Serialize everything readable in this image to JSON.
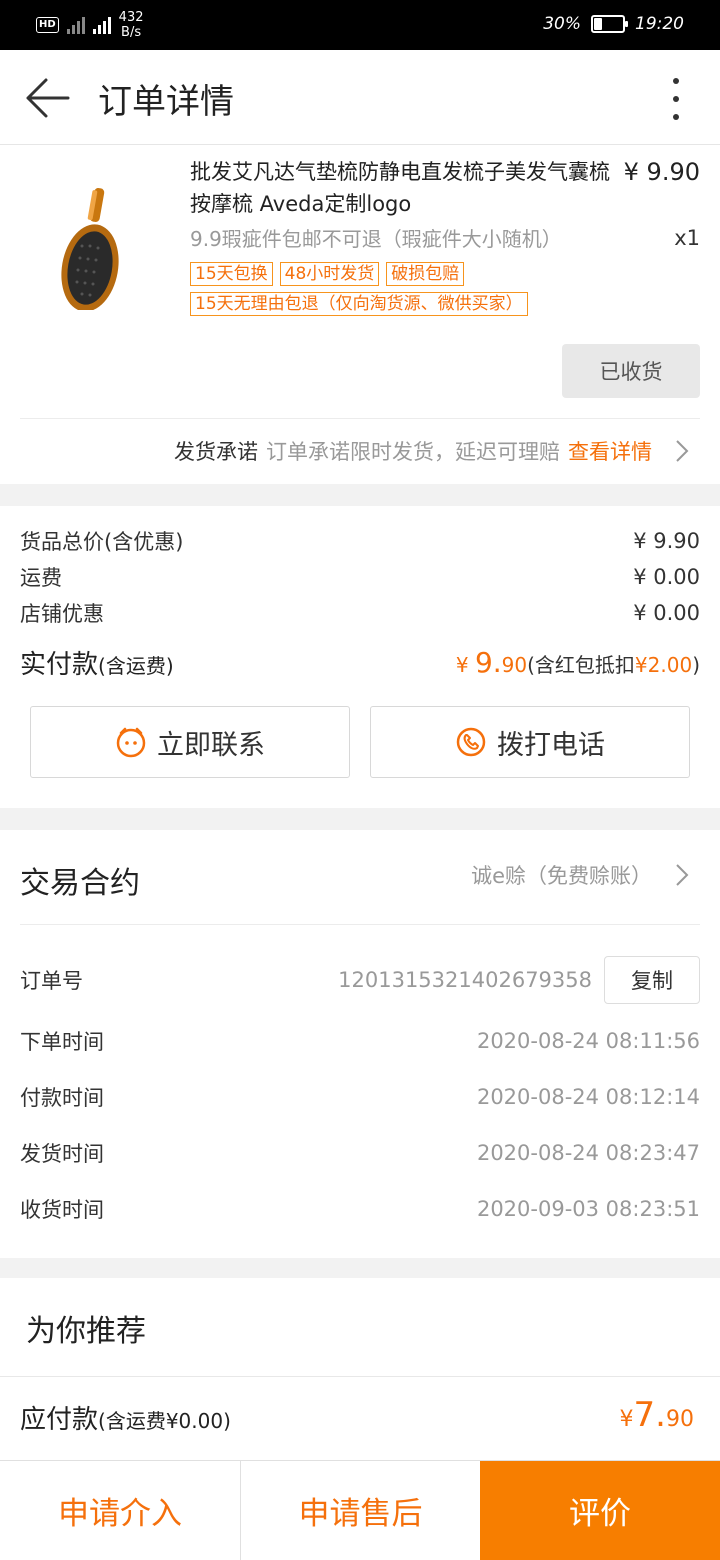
{
  "status_bar": {
    "network_speed": "432\nB/s",
    "battery": "30%",
    "battery_level": 0.3,
    "time": "19:20"
  },
  "header": {
    "title": "订单详情"
  },
  "product": {
    "title": "批发艾凡达气垫梳防静电直发梳子美发气囊梳按摩梳 Aveda定制logo",
    "price": "¥ 9.90",
    "spec": "9.9瑕疵件包邮不可退（瑕疵件大小随机）",
    "quantity": "x1",
    "tags": [
      "15天包换",
      "48小时发货",
      "破损包赔",
      "15天无理由包退（仅向淘货源、微供买家）"
    ],
    "status_button": "已收货",
    "promise": {
      "label": "发货承诺",
      "text": "订单承诺限时发货，延迟可理赔",
      "link": "查看详情"
    }
  },
  "pricing": {
    "rows": [
      {
        "label": "货品总价(含优惠)",
        "value": "¥ 9.90"
      },
      {
        "label": "运费",
        "value": "¥ 0.00"
      },
      {
        "label": "店铺优惠",
        "value": "¥ 0.00"
      }
    ],
    "paid_label": "实付款",
    "paid_label_note": "(含运费)",
    "paid_currency": "¥ ",
    "paid_int": "9.",
    "paid_dec": "90",
    "paid_note_pre": "(含红包抵扣",
    "paid_note_amount": "¥2.00",
    "paid_note_post": ")",
    "contact_button": "立即联系",
    "call_button": "拨打电话"
  },
  "contract": {
    "title": "交易合约",
    "value": "诚e赊（免费赊账）",
    "order_no_label": "订单号",
    "order_no": "1201315321402679358",
    "copy_button": "复制",
    "times": [
      {
        "label": "下单时间",
        "value": "2020-08-24 08:11:56"
      },
      {
        "label": "付款时间",
        "value": "2020-08-24 08:12:14"
      },
      {
        "label": "发货时间",
        "value": "2020-08-24 08:23:47"
      },
      {
        "label": "收货时间",
        "value": "2020-09-03 08:23:51"
      }
    ]
  },
  "recommend": {
    "title": "为你推荐"
  },
  "payable": {
    "label": "应付款",
    "note": "(含运费¥0.00)",
    "currency": "¥",
    "int": "7.",
    "dec": "90"
  },
  "bottom_actions": {
    "intervene": "申请介入",
    "after_sales": "申请售后",
    "review": "评价"
  },
  "colors": {
    "accent": "#f5700c",
    "primary_button": "#f77e00",
    "section_gap": "#f2f2f2"
  }
}
